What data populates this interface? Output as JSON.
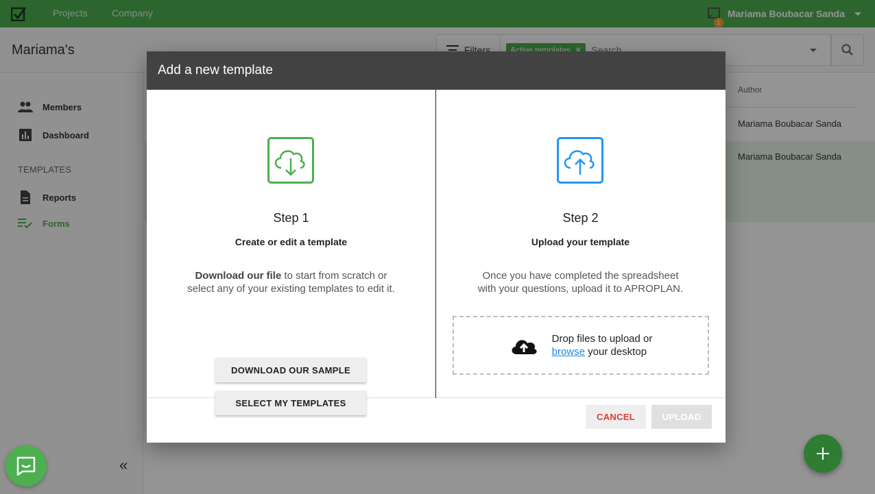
{
  "topbar": {
    "nav": [
      "Projects",
      "Company"
    ],
    "notification_count": "1",
    "user_name": "Mariama Boubacar Sanda"
  },
  "page": {
    "title": "Mariama's"
  },
  "filterbar": {
    "filters_label": "Filters",
    "active_chip": "Active templates",
    "search_placeholder": "Search"
  },
  "sidebar": {
    "items": [
      {
        "label": "Members",
        "icon": "people-icon"
      },
      {
        "label": "Dashboard",
        "icon": "bar-chart-icon"
      }
    ],
    "section_label": "TEMPLATES",
    "template_items": [
      {
        "label": "Reports",
        "icon": "document-icon"
      },
      {
        "label": "Forms",
        "icon": "checklist-icon",
        "active": true
      }
    ]
  },
  "table": {
    "author_header": "Author",
    "rows": [
      {
        "author": "Mariama Boubacar Sanda"
      },
      {
        "author": "Mariama Boubacar Sanda"
      }
    ]
  },
  "modal": {
    "title": "Add a new template",
    "step1": {
      "title": "Step 1",
      "subtitle": "Create or edit a template",
      "desc_bold": "Download our file",
      "desc_rest_1": " to start from scratch or",
      "desc_line_2": "select any of your existing templates to edit it.",
      "download_button": "DOWNLOAD OUR SAMPLE",
      "select_button": "SELECT MY TEMPLATES"
    },
    "step2": {
      "title": "Step 2",
      "subtitle": "Upload your template",
      "desc_line_1": "Once you have completed the spreadsheet",
      "desc_line_2": "with your questions, upload it to APROPLAN.",
      "drop_text_1": "Drop files to upload or",
      "drop_link": "browse",
      "drop_text_2": " your desktop"
    },
    "cancel_button": "CANCEL",
    "upload_button": "UPLOAD"
  },
  "colors": {
    "brand_green": "#4caf50",
    "dark_green": "#2e7d32",
    "step1_icon": "#4caf50",
    "step2_icon": "#2196f3",
    "cancel_text": "#e53935",
    "link": "#1e88e5"
  }
}
